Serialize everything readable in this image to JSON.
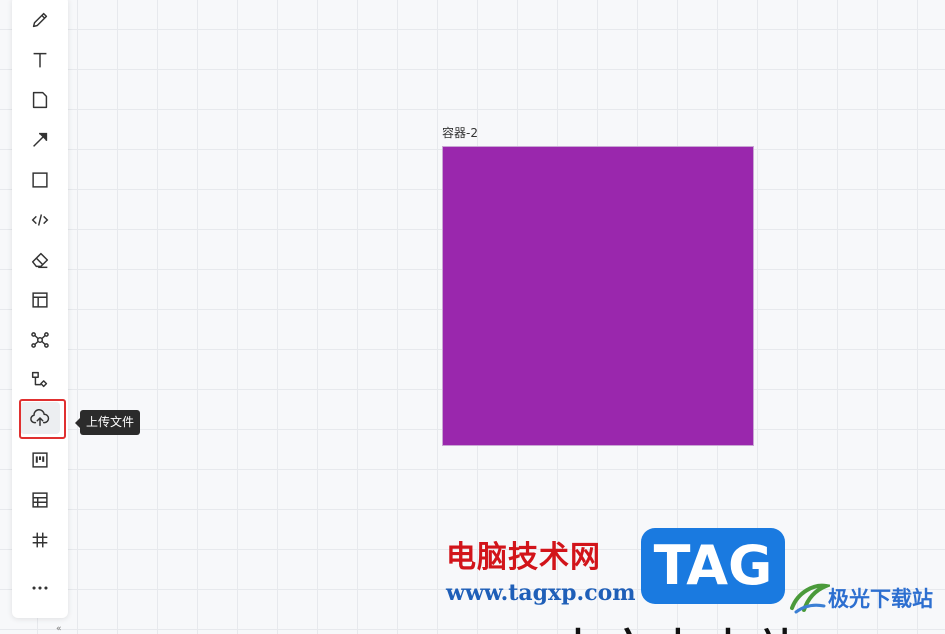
{
  "toolbar": {
    "tools": [
      {
        "name": "pen-tool",
        "icon": "pencil-icon"
      },
      {
        "name": "text-tool",
        "icon": "text-icon"
      },
      {
        "name": "sticky-note-tool",
        "icon": "note-icon"
      },
      {
        "name": "arrow-tool",
        "icon": "arrow-icon"
      },
      {
        "name": "shape-tool",
        "icon": "rectangle-icon"
      },
      {
        "name": "code-tool",
        "icon": "code-icon"
      },
      {
        "name": "eraser-tool",
        "icon": "eraser-icon"
      },
      {
        "name": "layout-tool",
        "icon": "layout-icon"
      },
      {
        "name": "mindmap-tool",
        "icon": "mindmap-icon"
      },
      {
        "name": "flowchart-tool",
        "icon": "flowchart-icon"
      },
      {
        "name": "upload-file-tool",
        "icon": "cloud-upload-icon"
      },
      {
        "name": "kanban-tool",
        "icon": "kanban-icon"
      },
      {
        "name": "table-tool",
        "icon": "table-icon"
      },
      {
        "name": "frame-tool",
        "icon": "hash-frame-icon"
      },
      {
        "name": "more-tool",
        "icon": "more-icon"
      }
    ],
    "active_tool": "upload-file-tool",
    "tooltip": "上传文件",
    "zoom_handle": "«"
  },
  "canvas": {
    "container": {
      "label": "容器-2",
      "fill_color": "#9a27ad"
    }
  },
  "watermark": {
    "cn_text": "电脑技术网",
    "url_text": "www.tagxp.com",
    "tag_text": "TAG",
    "site_text": "极光下载站",
    "bottom_text": "本文由本站"
  },
  "colors": {
    "highlight": "#e03030",
    "tooltip_bg": "#2b2b2b",
    "tag_blue": "#1a7ae0",
    "watermark_red": "#d2141a"
  }
}
